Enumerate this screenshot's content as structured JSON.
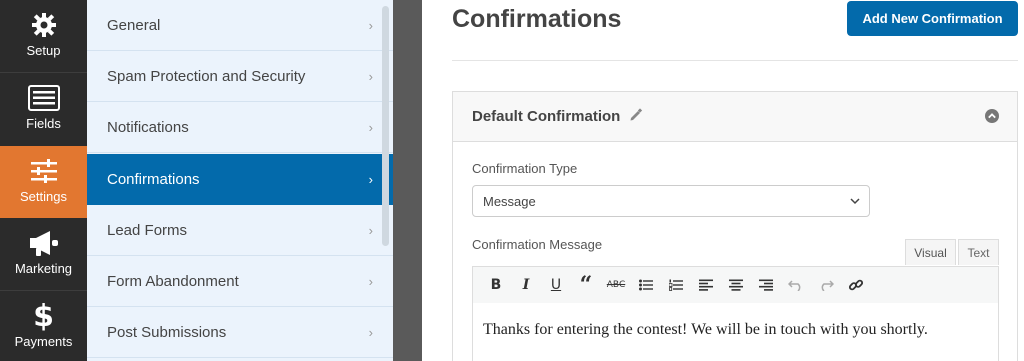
{
  "rail": {
    "items": [
      {
        "label": "Setup",
        "icon": "gear-icon"
      },
      {
        "label": "Fields",
        "icon": "list-icon"
      },
      {
        "label": "Settings",
        "icon": "sliders-icon",
        "active": true
      },
      {
        "label": "Marketing",
        "icon": "megaphone-icon"
      },
      {
        "label": "Payments",
        "icon": "dollar-icon"
      }
    ]
  },
  "nav": {
    "items": [
      {
        "label": "General"
      },
      {
        "label": "Spam Protection and Security"
      },
      {
        "label": "Notifications"
      },
      {
        "label": "Confirmations",
        "active": true
      },
      {
        "label": "Lead Forms"
      },
      {
        "label": "Form Abandonment"
      },
      {
        "label": "Post Submissions"
      }
    ]
  },
  "main": {
    "title": "Confirmations",
    "add_button": "Add New Confirmation",
    "panel": {
      "title": "Default Confirmation",
      "type_label": "Confirmation Type",
      "type_value": "Message",
      "message_label": "Confirmation Message",
      "tabs": {
        "visual": "Visual",
        "text": "Text"
      },
      "message_text": "Thanks for entering the contest! We will be in touch with you shortly."
    }
  },
  "colors": {
    "rail_bg": "#2b2b2b",
    "rail_active": "#e27730",
    "nav_bg": "#ebf3fc",
    "nav_active": "#036aab",
    "primary_button": "#036aab"
  }
}
